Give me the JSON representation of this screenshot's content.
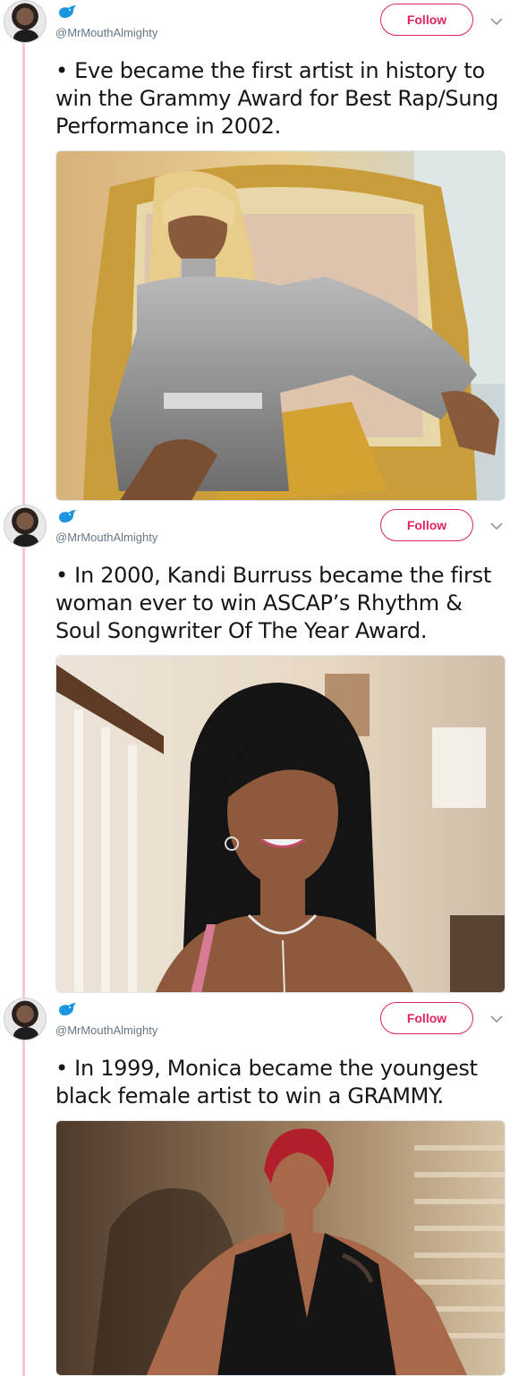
{
  "thread": {
    "accent_color": "#e0245e",
    "line_color": "#f5c9d6",
    "tweets": [
      {
        "handle": "@MrMouthAlmighty",
        "follow_label": "Follow",
        "text": "• Eve became the first artist in history to win the Grammy Award for Best Rap/Sung Performance in 2002.",
        "media_icon": "photo-woman-blonde-gold-chair"
      },
      {
        "handle": "@MrMouthAlmighty",
        "follow_label": "Follow",
        "text": "• In 2000, Kandi Burruss became the first woman ever to win ASCAP’s Rhythm & Soul Songwriter Of The Year Award.",
        "media_icon": "photo-woman-long-black-hair"
      },
      {
        "handle": "@MrMouthAlmighty",
        "follow_label": "Follow",
        "text": "• In 1999, Monica became the youngest black female artist to win a GRAMMY.",
        "media_icon": "photo-woman-red-hair-black-top"
      }
    ]
  }
}
